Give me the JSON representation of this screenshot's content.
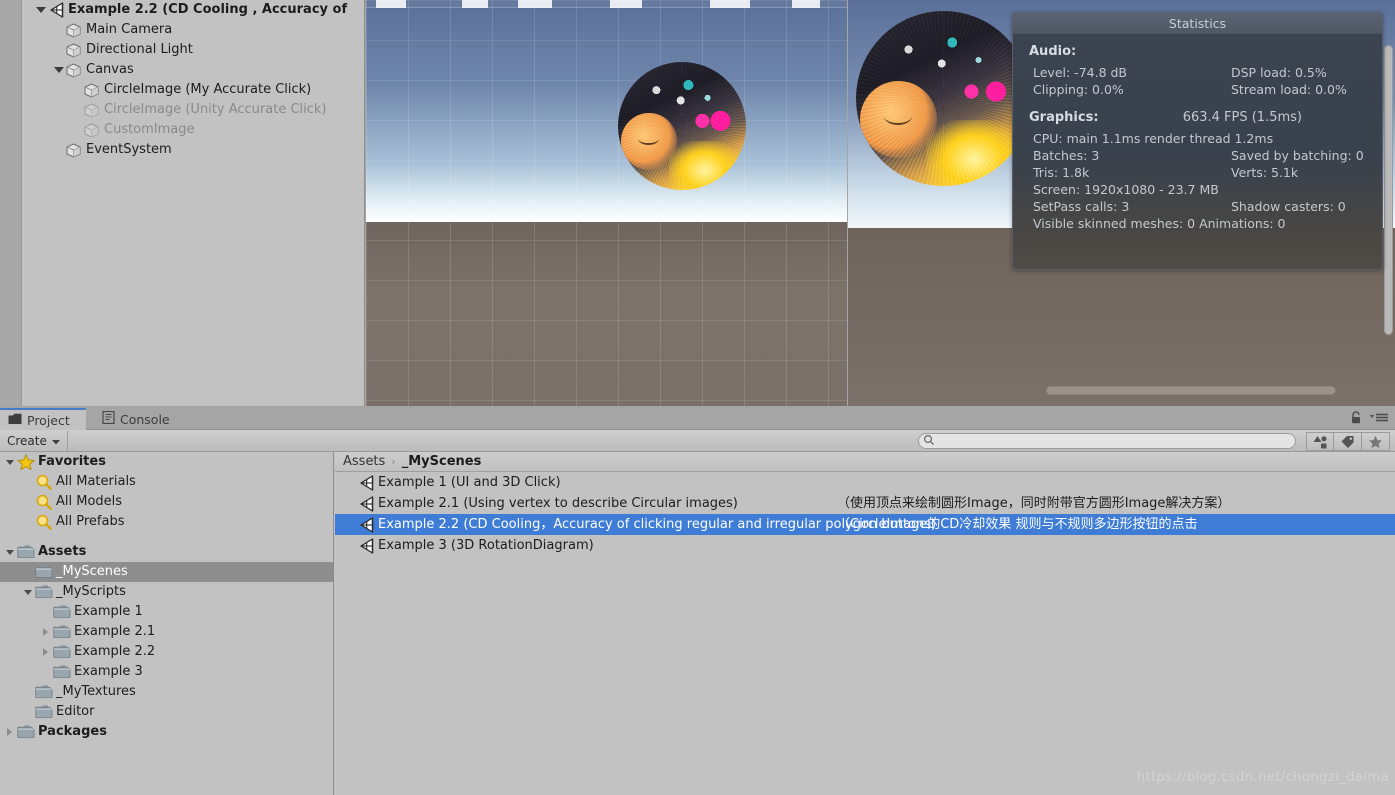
{
  "hierarchy": {
    "rows": [
      {
        "label": "Example 2.2 (CD Cooling , Accuracy of",
        "indent": 0,
        "icon": "unity-scene-icon",
        "arrow": "down",
        "bold": true,
        "dim": false
      },
      {
        "label": "Main Camera",
        "indent": 1,
        "icon": "gameobject-cube-icon",
        "arrow": "none",
        "bold": false,
        "dim": false
      },
      {
        "label": "Directional Light",
        "indent": 1,
        "icon": "gameobject-cube-icon",
        "arrow": "none",
        "bold": false,
        "dim": false
      },
      {
        "label": "Canvas",
        "indent": 1,
        "icon": "gameobject-cube-icon",
        "arrow": "down",
        "bold": false,
        "dim": false
      },
      {
        "label": "CircleImage (My Accurate Click)",
        "indent": 2,
        "icon": "gameobject-cube-icon",
        "arrow": "none",
        "bold": false,
        "dim": false
      },
      {
        "label": "CircleImage (Unity Accurate Click)",
        "indent": 2,
        "icon": "gameobject-cube-icon",
        "arrow": "none",
        "bold": false,
        "dim": true
      },
      {
        "label": "CustomImage",
        "indent": 2,
        "icon": "gameobject-cube-icon",
        "arrow": "none",
        "bold": false,
        "dim": true
      },
      {
        "label": "EventSystem",
        "indent": 1,
        "icon": "gameobject-cube-icon",
        "arrow": "none",
        "bold": false,
        "dim": false
      }
    ]
  },
  "statistics": {
    "title": "Statistics",
    "audio_heading": "Audio:",
    "audio": [
      {
        "left": "Level: -74.8 dB",
        "right": "DSP load: 0.5%"
      },
      {
        "left": "Clipping: 0.0%",
        "right": "Stream load: 0.0%"
      }
    ],
    "graphics_heading": "Graphics:",
    "fps": "663.4 FPS (1.5ms)",
    "graphics": [
      {
        "full": "CPU: main 1.1ms  render thread 1.2ms"
      },
      {
        "left": "Batches: 3",
        "right": "Saved by batching: 0"
      },
      {
        "left": "Tris: 1.8k",
        "right": "Verts: 5.1k"
      },
      {
        "full": "Screen: 1920x1080 - 23.7 MB"
      },
      {
        "left": "SetPass calls: 3",
        "right": "Shadow casters: 0"
      },
      {
        "full": "Visible skinned meshes: 0  Animations: 0"
      }
    ]
  },
  "tabs": [
    {
      "label": "Project",
      "icon": "project-folder-icon",
      "active": true
    },
    {
      "label": "Console",
      "icon": "console-icon",
      "active": false
    }
  ],
  "tabbar_icons": [
    {
      "name": "lock-icon"
    },
    {
      "name": "panel-menu-icon"
    }
  ],
  "toolbar": {
    "create_label": "Create",
    "search_placeholder": "",
    "search_value": "",
    "filter_buttons": [
      {
        "name": "filter-by-type-icon"
      },
      {
        "name": "filter-by-label-icon"
      },
      {
        "name": "filter-favorites-star-icon"
      }
    ]
  },
  "project_tree": {
    "rows": [
      {
        "label": "Favorites",
        "indent": 0,
        "icon": "star-icon",
        "arrow": "down",
        "bold": true,
        "selected": false
      },
      {
        "label": "All Materials",
        "indent": 1,
        "icon": "search-saved-icon",
        "arrow": "none",
        "bold": false,
        "selected": false
      },
      {
        "label": "All Models",
        "indent": 1,
        "icon": "search-saved-icon",
        "arrow": "none",
        "bold": false,
        "selected": false
      },
      {
        "label": "All Prefabs",
        "indent": 1,
        "icon": "search-saved-icon",
        "arrow": "none",
        "bold": false,
        "selected": false
      },
      {
        "spacer": true
      },
      {
        "label": "Assets",
        "indent": 0,
        "icon": "folder-icon",
        "arrow": "down",
        "bold": true,
        "selected": false
      },
      {
        "label": "_MyScenes",
        "indent": 1,
        "icon": "folder-icon",
        "arrow": "none",
        "bold": false,
        "selected": true
      },
      {
        "label": "_MyScripts",
        "indent": 1,
        "icon": "folder-icon",
        "arrow": "down",
        "bold": false,
        "selected": false
      },
      {
        "label": "Example 1",
        "indent": 2,
        "icon": "folder-icon",
        "arrow": "none",
        "bold": false,
        "selected": false
      },
      {
        "label": "Example 2.1",
        "indent": 2,
        "icon": "folder-icon",
        "arrow": "right",
        "bold": false,
        "selected": false
      },
      {
        "label": "Example 2.2",
        "indent": 2,
        "icon": "folder-icon",
        "arrow": "right",
        "bold": false,
        "selected": false
      },
      {
        "label": "Example 3",
        "indent": 2,
        "icon": "folder-icon",
        "arrow": "none",
        "bold": false,
        "selected": false
      },
      {
        "label": "_MyTextures",
        "indent": 1,
        "icon": "folder-icon",
        "arrow": "none",
        "bold": false,
        "selected": false
      },
      {
        "label": "Editor",
        "indent": 1,
        "icon": "folder-icon",
        "arrow": "none",
        "bold": false,
        "selected": false
      },
      {
        "label": "Packages",
        "indent": 0,
        "icon": "folder-icon",
        "arrow": "right",
        "bold": true,
        "selected": false
      }
    ]
  },
  "breadcrumb": {
    "root": "Assets",
    "separator": "›",
    "current": "_MyScenes"
  },
  "files": [
    {
      "name": "Example 1 (UI and 3D Click)",
      "note": "",
      "icon": "unity-scene-icon",
      "selected": false
    },
    {
      "name": "Example 2.1 (Using vertex to describe Circular images)",
      "note": "（使用顶点来绘制圆形Image，同时附带官方圆形Image解决方案）",
      "icon": "unity-scene-icon",
      "selected": false
    },
    {
      "name": "Example 2.2 (CD Cooling，Accuracy of clicking regular and irregular polygon buttons)",
      "note": "（CircleImage的CD冷却效果  规则与不规则多边形按钮的点击",
      "icon": "unity-scene-icon",
      "selected": true
    },
    {
      "name": "Example 3 (3D RotationDiagram)",
      "note": "",
      "icon": "unity-scene-icon",
      "selected": false
    }
  ],
  "watermark": "https://blog.csdn.net/chongzi_daima",
  "colors": {
    "selection_blue": "#3e7cd6",
    "panel_gray": "#c2c2c2",
    "chrome_gray": "#a5a5a5",
    "tree_selected_gray": "#8e8e8e",
    "tab_accent": "#4b7bc4"
  }
}
